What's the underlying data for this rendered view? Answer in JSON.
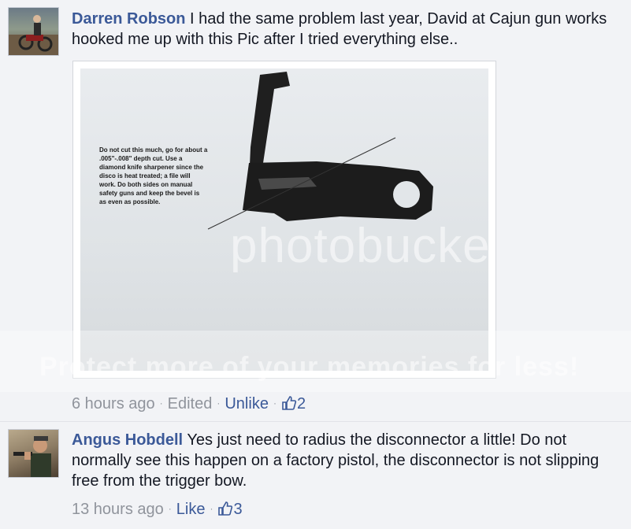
{
  "comments": [
    {
      "author": "Darren Robson",
      "text": "I had the same problem last year, David at Cajun gun works hooked me up with this Pic after I tried everything else..",
      "photo": {
        "note": "Do not cut this much, go for about a .005\"-.008\" depth cut. Use a diamond knife sharpener since the disco is heat treated; a file will work. Do both sides on manual safety guns and keep the bevel is as even as possible.",
        "watermark": "photobucket"
      },
      "banner": "Protect more of your memories for less!",
      "time": "6 hours ago",
      "edited": "Edited",
      "action": "Unlike",
      "likes": "2"
    },
    {
      "author": "Angus Hobdell",
      "text": "Yes just need to radius the disconnector a little! Do not normally see this happen on a factory pistol, the disconnector is not slipping free from the trigger bow.",
      "time": "13 hours ago",
      "action": "Like",
      "likes": "3"
    }
  ],
  "colors": {
    "link": "#3b5998",
    "meta": "#90949c",
    "background": "#f2f3f6"
  }
}
